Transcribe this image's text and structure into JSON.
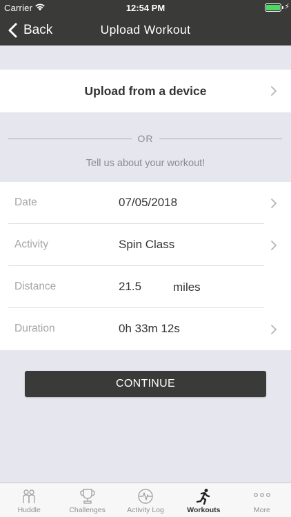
{
  "status_bar": {
    "carrier": "Carrier",
    "time": "12:54 PM",
    "icons": [
      "wifi-icon",
      "battery-icon",
      "charging-bolt-icon"
    ]
  },
  "nav": {
    "back_label": "Back",
    "title": "Upload Workout"
  },
  "upload": {
    "label": "Upload from a device"
  },
  "divider": {
    "or_text": "OR",
    "prompt": "Tell us about your workout!"
  },
  "form": {
    "rows": [
      {
        "label": "Date",
        "value": "07/05/2018",
        "unit": "",
        "has_chevron": true
      },
      {
        "label": "Activity",
        "value": "Spin Class",
        "unit": "",
        "has_chevron": true
      },
      {
        "label": "Distance",
        "value": "21.5",
        "unit": "miles",
        "has_chevron": false
      },
      {
        "label": "Duration",
        "value": "0h 33m 12s",
        "unit": "",
        "has_chevron": true
      }
    ]
  },
  "continue_label": "CONTINUE",
  "tabs": [
    {
      "label": "Huddle",
      "icon": "huddle-icon",
      "active": false
    },
    {
      "label": "Challenges",
      "icon": "trophy-icon",
      "active": false
    },
    {
      "label": "Activity Log",
      "icon": "pulse-icon",
      "active": false
    },
    {
      "label": "Workouts",
      "icon": "runner-icon",
      "active": true
    },
    {
      "label": "More",
      "icon": "more-dots-icon",
      "active": false
    }
  ],
  "colors": {
    "header_bg": "#3a3a39",
    "page_bg": "#e6e6ee",
    "battery_green": "#4cd964",
    "muted_text": "#8a8a92"
  }
}
